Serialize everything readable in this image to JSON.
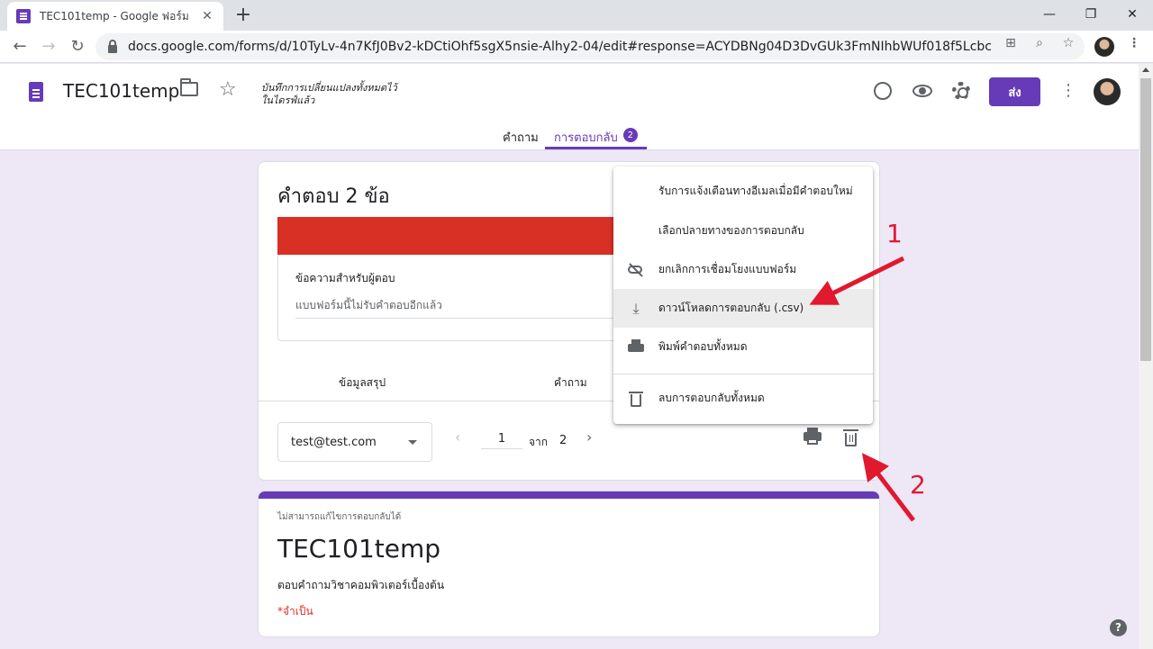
{
  "browser": {
    "tab_title": "TEC101temp - Google ฟอร์ม",
    "url": "docs.google.com/forms/d/10TyLv-4n7KfJ0Bv2-kDCtiOhf5sgX5nsie-Alhy2-04/edit#response=ACYDBNg04D3DvGUk3FmNIhbWUf018f5Lcbc9VWFGhBoQa..."
  },
  "header": {
    "title": "TEC101temp",
    "save_status": "บันทึกการเปลี่ยนแปลงทั้งหมดไว้ในไดรฟ์แล้ว",
    "send_label": "ส่ง"
  },
  "tabs": {
    "questions": "คำถาม",
    "responses": "การตอบกลับ",
    "responses_count": "2"
  },
  "responses": {
    "count_title": "คำตอบ 2 ข้อ",
    "message_label": "ข้อความสำหรับผู้ตอบ",
    "message_placeholder": "แบบฟอร์มนี้ไม่รับคำตอบอีกแล้ว",
    "subtab_summary": "ข้อมูลสรุป",
    "subtab_question": "คำถาม",
    "selected_email": "test@test.com",
    "page_current": "1",
    "page_of": "จาก",
    "page_total": "2"
  },
  "menu": {
    "items": [
      "รับการแจ้งเตือนทางอีเมลเมื่อมีคำตอบใหม่",
      "เลือกปลายทางของการตอบกลับ",
      "ยกเลิกการเชื่อมโยงแบบฟอร์ม",
      "ดาวน์โหลดการตอบกลับ (.csv)",
      "พิมพ์คำตอบทั้งหมด",
      "ลบการตอบกลับทั้งหมด"
    ]
  },
  "form_card": {
    "edit_note": "ไม่สามารถแก้ไขการตอบกลับได้",
    "title": "TEC101temp",
    "description": "ตอบคำถามวิชาคอมพิวเตอร์เบื้องต้น",
    "required_note": "*จำเป็น"
  },
  "annotations": {
    "label_1": "1",
    "label_2": "2"
  },
  "colors": {
    "brand": "#673ab7",
    "closed_bar": "#d93025",
    "annotation": "#e0192f"
  }
}
